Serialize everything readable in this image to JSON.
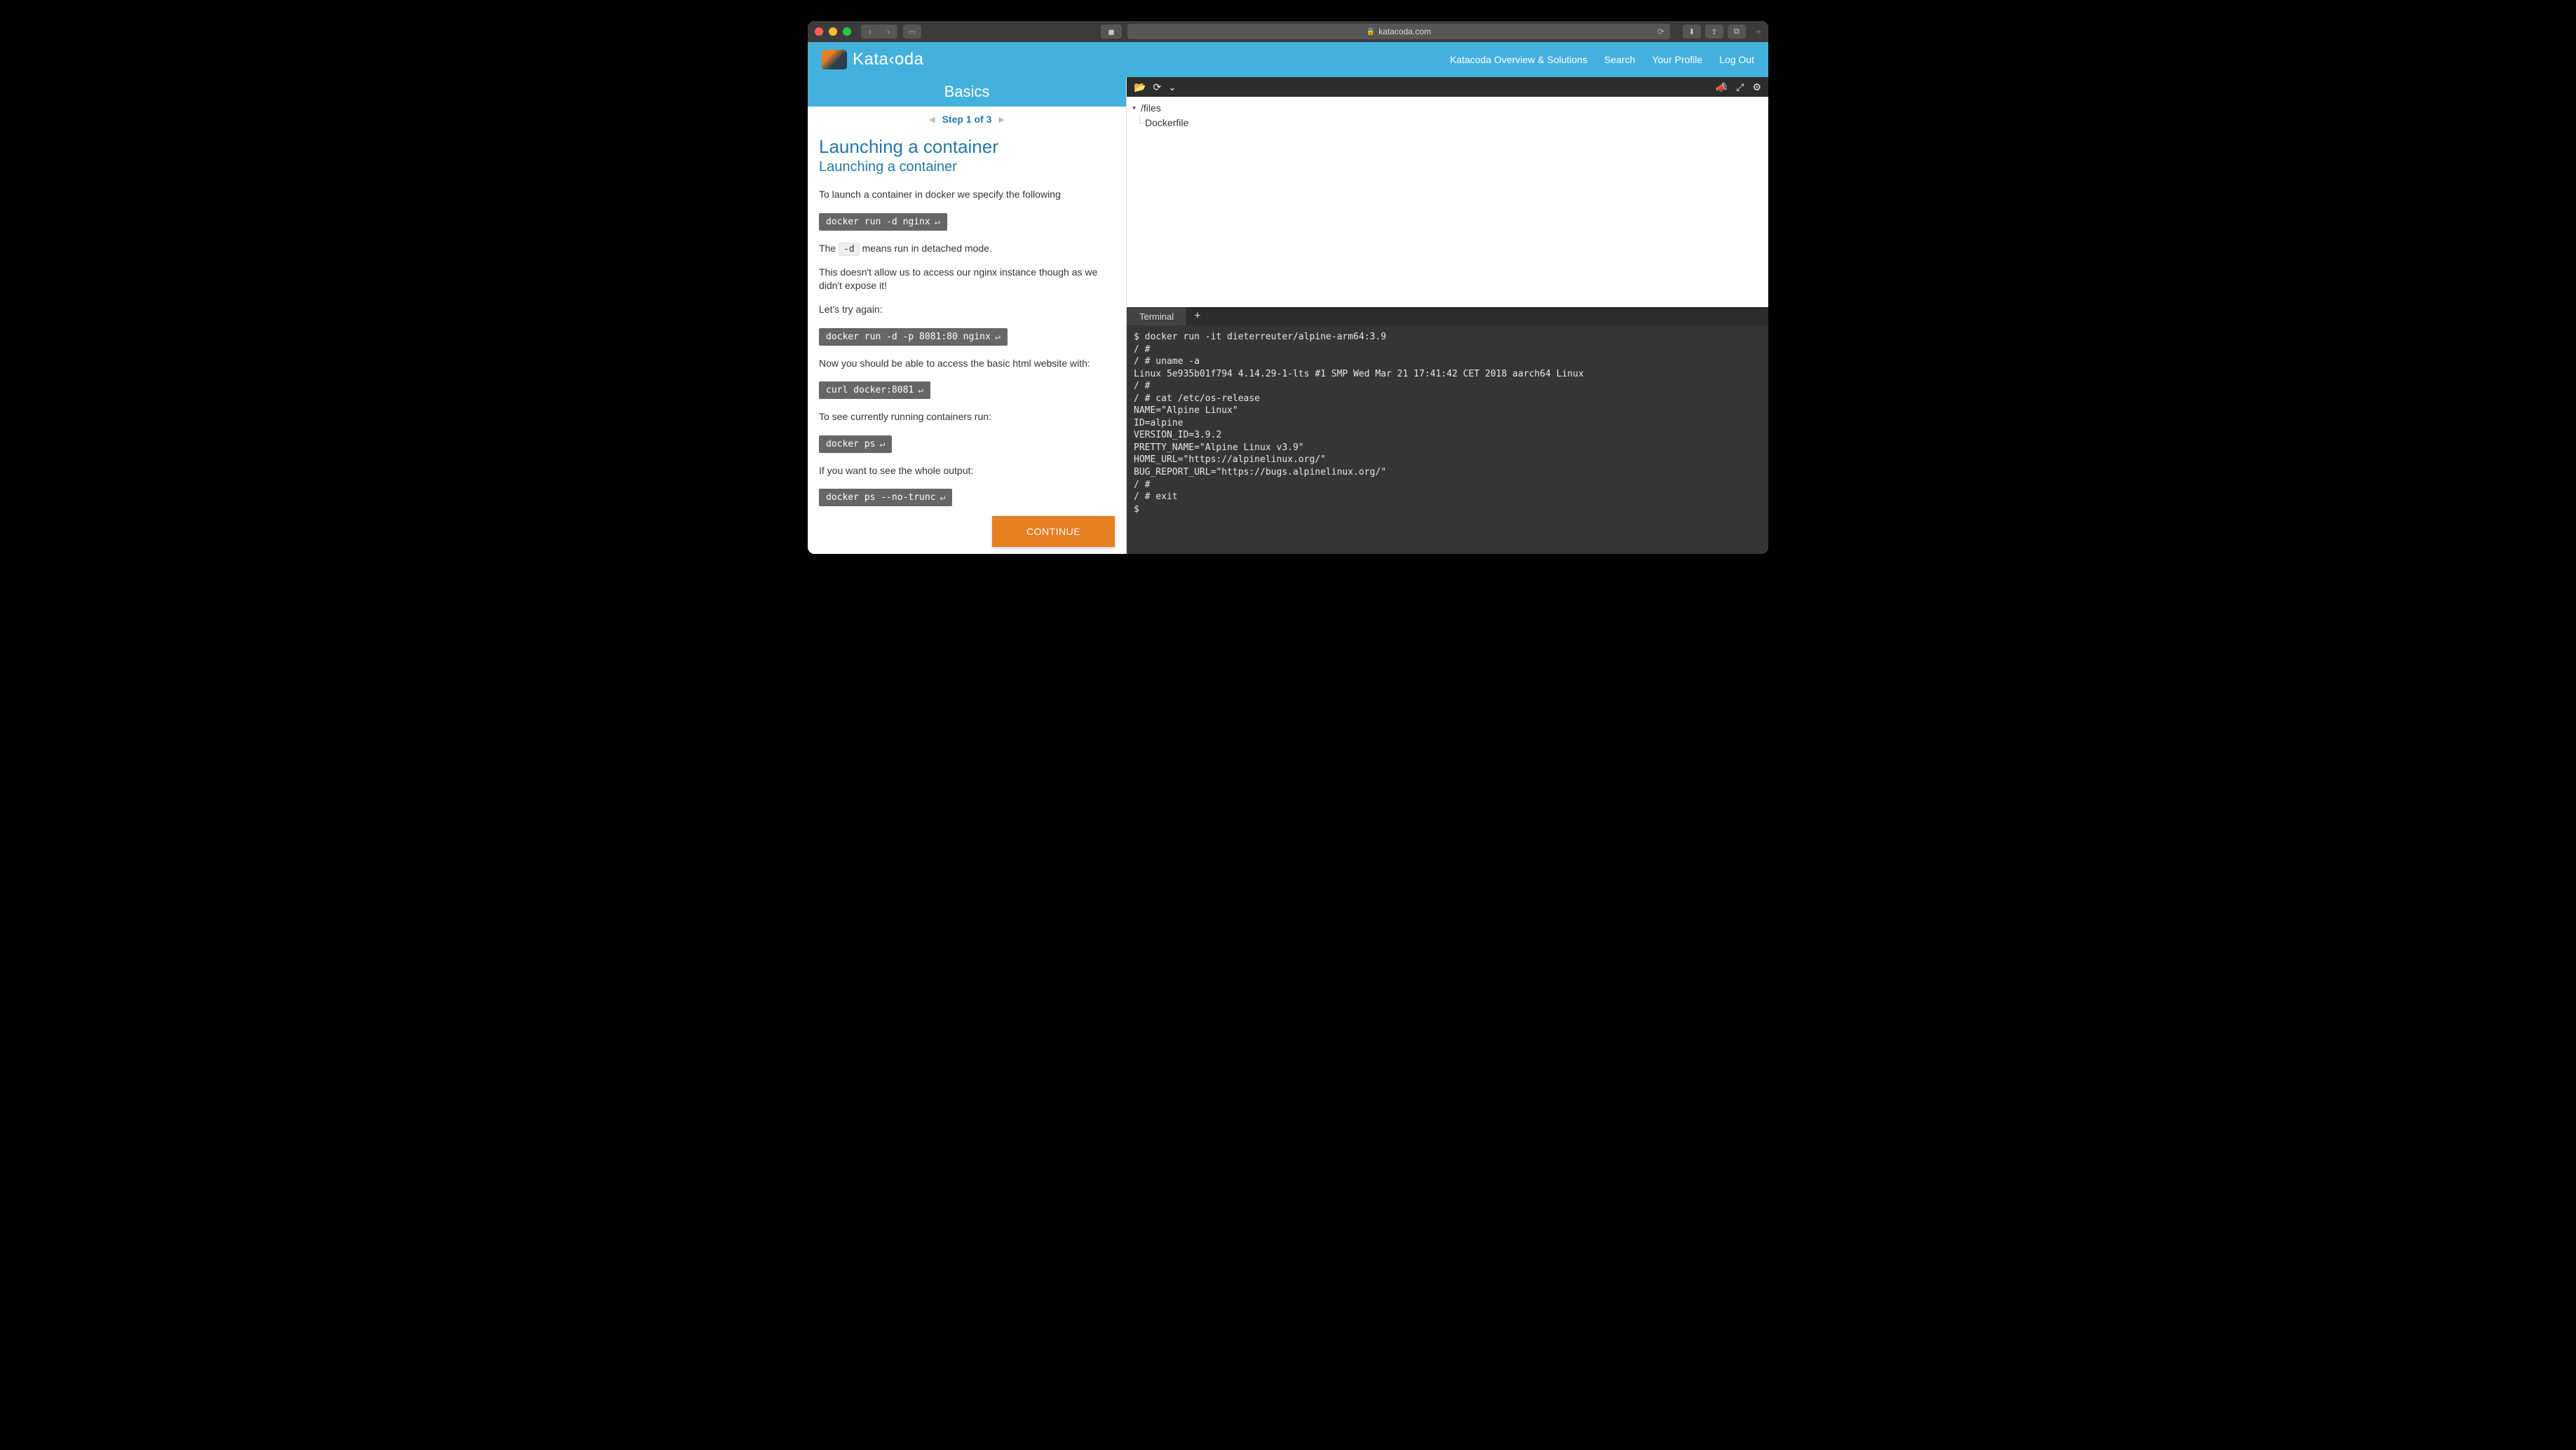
{
  "browser": {
    "url_display": "katacoda.com",
    "lock_icon": "🔒"
  },
  "nav": {
    "brand": "Kata‹oda",
    "links": [
      "Katacoda Overview & Solutions",
      "Search",
      "Your Profile",
      "Log Out"
    ]
  },
  "lesson": {
    "header": "Basics",
    "step_label": "Step 1 of 3",
    "title": "Launching a container",
    "subtitle": "Launching a container",
    "p_intro": "To launch a container in docker we specify the following",
    "code1": "docker run -d nginx",
    "p_detached_pre": "The ",
    "inline_flag": "-d",
    "p_detached_post": " means run in detached mode.",
    "p_noexpose": "This doesn't allow us to access our nginx instance though as we didn't expose it!",
    "p_tryagain": "Let's try again:",
    "code2": "docker run -d -p 8081:80 nginx",
    "p_access": "Now you should be able to access the basic html website with:",
    "code3": "curl docker:8081",
    "p_ps": "To see currently running containers run:",
    "code4": "docker ps",
    "p_whole": "If you want to see the whole output:",
    "code5": "docker ps --no-trunc",
    "continue": "CONTINUE"
  },
  "filetree": {
    "root": "/files",
    "children": [
      "Dockerfile"
    ]
  },
  "terminal": {
    "tab": "Terminal",
    "lines": [
      "$ docker run -it dieterreuter/alpine-arm64:3.9",
      "/ #",
      "/ # uname -a",
      "Linux 5e935b01f794 4.14.29-1-lts #1 SMP Wed Mar 21 17:41:42 CET 2018 aarch64 Linux",
      "/ #",
      "/ # cat /etc/os-release",
      "NAME=\"Alpine Linux\"",
      "ID=alpine",
      "VERSION_ID=3.9.2",
      "PRETTY_NAME=\"Alpine Linux v3.9\"",
      "HOME_URL=\"https://alpinelinux.org/\"",
      "BUG_REPORT_URL=\"https://bugs.alpinelinux.org/\"",
      "/ #",
      "/ # exit",
      "$"
    ]
  },
  "icons": {
    "enter": "↵"
  }
}
